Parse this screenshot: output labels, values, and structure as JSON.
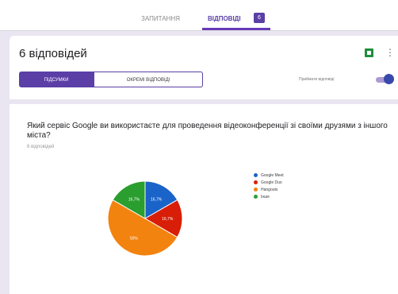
{
  "tabs": {
    "questions": "ЗАПИТАННЯ",
    "answers": "ВІДПОВІДІ",
    "answers_badge": "6"
  },
  "header": {
    "response_count": "6 відповідей",
    "sheets_icon": "google-sheets-icon",
    "more_icon": "more-vert-icon"
  },
  "view": {
    "summary_label": "ПІДСУМКИ",
    "individual_label": "ОКРЕМІ ВІДПОВІДІ",
    "accepting_label": "Приймати відповіді",
    "accepting": true
  },
  "question": {
    "text": "Який сервіс Google ви використаєте для проведення відеоконференції зі своїми друзями з іншого міста?",
    "sub": "6 відповідей"
  },
  "colors": {
    "accent": "#673ab7",
    "blue": "#1a63c9",
    "red": "#d81e06",
    "orange": "#f3830f",
    "green": "#2a9e2f"
  },
  "chart_data": {
    "type": "pie",
    "slices": [
      {
        "label": "Google Meet",
        "value": 16.7,
        "display": "16,7%",
        "color": "#1a63c9"
      },
      {
        "label": "Google Duo",
        "value": 16.7,
        "display": "16,7%",
        "color": "#d81e06"
      },
      {
        "label": "Hangouts",
        "value": 50.0,
        "display": "50%",
        "color": "#f3830f"
      },
      {
        "label": "Інше",
        "value": 16.7,
        "display": "16,7%",
        "color": "#2a9e2f"
      }
    ],
    "start_angle_deg": 90,
    "direction": "clockwise",
    "legend_position": "right"
  }
}
